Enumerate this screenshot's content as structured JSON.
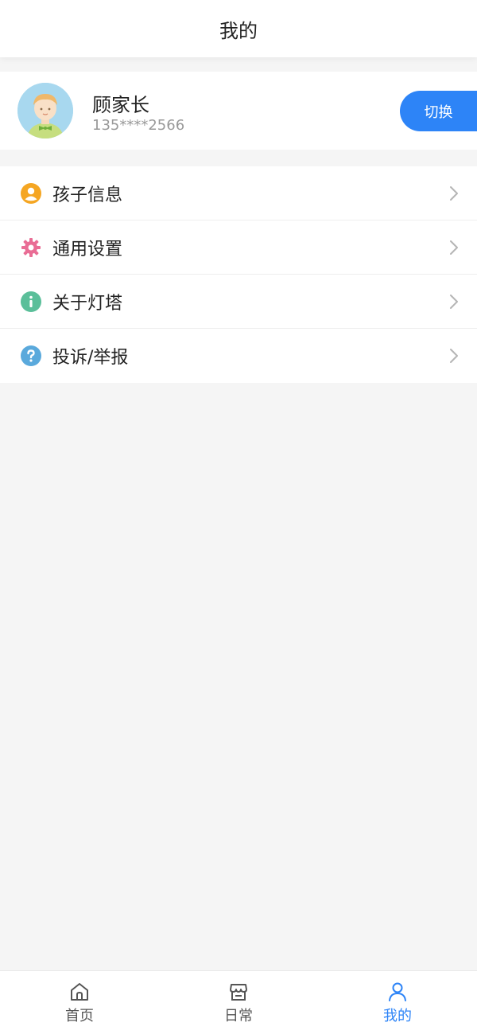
{
  "header": {
    "title": "我的"
  },
  "user": {
    "name": "顾家长",
    "phone": "135****2566",
    "switch_label": "切换"
  },
  "menu": [
    {
      "label": "孩子信息",
      "icon": "user-circle-icon",
      "color": "#f5a623"
    },
    {
      "label": "通用设置",
      "icon": "gear-icon",
      "color": "#e96d95"
    },
    {
      "label": "关于灯塔",
      "icon": "info-icon",
      "color": "#5bbf9a"
    },
    {
      "label": "投诉/举报",
      "icon": "question-icon",
      "color": "#5aa9dc"
    }
  ],
  "tabbar": {
    "tabs": [
      {
        "label": "首页",
        "icon": "home-icon",
        "active": false
      },
      {
        "label": "日常",
        "icon": "store-icon",
        "active": false
      },
      {
        "label": "我的",
        "icon": "person-icon",
        "active": true
      }
    ]
  },
  "colors": {
    "accent": "#2d84f7",
    "background": "#f5f5f5",
    "card": "#ffffff"
  }
}
